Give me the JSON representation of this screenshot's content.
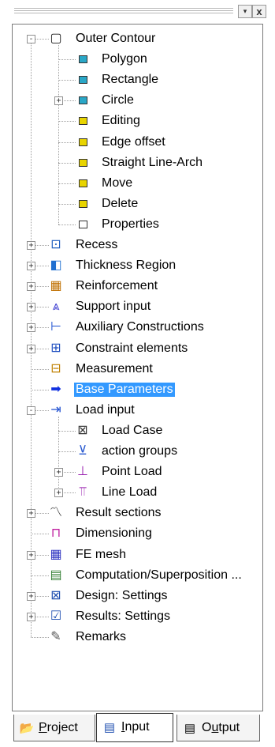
{
  "toolbar": {
    "close_glyph": "x",
    "menu_glyph": "▾"
  },
  "tree": {
    "items": [
      {
        "id": "outer-contour",
        "label": "Outer Contour",
        "level": 0,
        "expander": "-",
        "icon": "outer-contour-icon",
        "glyph": "▢",
        "color": "#1a1a1a"
      },
      {
        "id": "polygon",
        "label": "Polygon",
        "level": 1,
        "expander": "",
        "icon": "polygon-icon",
        "glyph": "sq",
        "color": "#2aa7c7"
      },
      {
        "id": "rectangle",
        "label": "Rectangle",
        "level": 1,
        "expander": "",
        "icon": "rectangle-icon",
        "glyph": "sq",
        "color": "#2aa7c7"
      },
      {
        "id": "circle",
        "label": "Circle",
        "level": 1,
        "expander": "+",
        "icon": "circle-icon",
        "glyph": "sq",
        "color": "#2aa7c7"
      },
      {
        "id": "editing",
        "label": "Editing",
        "level": 1,
        "expander": "",
        "icon": "editing-icon",
        "glyph": "sq",
        "color": "#e8d400"
      },
      {
        "id": "edge-offset",
        "label": "Edge offset",
        "level": 1,
        "expander": "",
        "icon": "edge-offset-icon",
        "glyph": "sq",
        "color": "#e8d400"
      },
      {
        "id": "straight-line-arch",
        "label": "Straight Line-Arch",
        "level": 1,
        "expander": "",
        "icon": "straight-line-arch-icon",
        "glyph": "sq",
        "color": "#e8d400"
      },
      {
        "id": "move",
        "label": "Move",
        "level": 1,
        "expander": "",
        "icon": "move-icon",
        "glyph": "sq",
        "color": "#e8d400"
      },
      {
        "id": "delete",
        "label": "Delete",
        "level": 1,
        "expander": "",
        "icon": "delete-icon",
        "glyph": "sq",
        "color": "#e8d400"
      },
      {
        "id": "properties",
        "label": "Properties",
        "level": 1,
        "expander": "",
        "icon": "properties-icon",
        "glyph": "sq",
        "color": "#ffffff"
      },
      {
        "id": "recess",
        "label": "Recess",
        "level": 0,
        "expander": "+",
        "icon": "recess-icon",
        "glyph": "⊡",
        "color": "#1f5fbf"
      },
      {
        "id": "thickness-region",
        "label": "Thickness Region",
        "level": 0,
        "expander": "+",
        "icon": "thickness-region-icon",
        "glyph": "◧",
        "color": "#1f6fd0"
      },
      {
        "id": "reinforcement",
        "label": "Reinforcement",
        "level": 0,
        "expander": "+",
        "icon": "reinforcement-icon",
        "glyph": "▦",
        "color": "#c07000"
      },
      {
        "id": "support-input",
        "label": "Support input",
        "level": 0,
        "expander": "+",
        "icon": "support-input-icon",
        "glyph": "⩓",
        "color": "#3a3ad0"
      },
      {
        "id": "auxiliary-constructions",
        "label": "Auxiliary Constructions",
        "level": 0,
        "expander": "+",
        "icon": "auxiliary-constructions-icon",
        "glyph": "⊢",
        "color": "#1a4fd0"
      },
      {
        "id": "constraint-elements",
        "label": "Constraint elements",
        "level": 0,
        "expander": "+",
        "icon": "constraint-elements-icon",
        "glyph": "⊞",
        "color": "#1f4fc0"
      },
      {
        "id": "measurement",
        "label": "Measurement",
        "level": 0,
        "expander": "",
        "icon": "measurement-icon",
        "glyph": "⊟",
        "color": "#c08000"
      },
      {
        "id": "base-parameters",
        "label": "Base Parameters",
        "level": 0,
        "expander": "",
        "icon": "arrow-right-icon",
        "glyph": "➡",
        "color": "#1030e0",
        "selected": true
      },
      {
        "id": "load-input",
        "label": "Load input",
        "level": 0,
        "expander": "-",
        "icon": "load-input-icon",
        "glyph": "⇥",
        "color": "#1f4fd0"
      },
      {
        "id": "load-case",
        "label": "Load Case",
        "level": 1,
        "expander": "",
        "icon": "load-case-icon",
        "glyph": "⊠",
        "color": "#333333"
      },
      {
        "id": "action-groups",
        "label": "action groups",
        "level": 1,
        "expander": "",
        "icon": "action-groups-icon",
        "glyph": "⊻",
        "color": "#2a5ad0"
      },
      {
        "id": "point-load",
        "label": "Point Load",
        "level": 1,
        "expander": "+",
        "icon": "point-load-icon",
        "glyph": "⊥",
        "color": "#9a20b0"
      },
      {
        "id": "line-load",
        "label": "Line Load",
        "level": 1,
        "expander": "+",
        "icon": "line-load-icon",
        "glyph": "⫪",
        "color": "#9a20b0"
      },
      {
        "id": "result-sections",
        "label": "Result sections",
        "level": 0,
        "expander": "+",
        "icon": "result-sections-icon",
        "glyph": "〽",
        "color": "#2a2a2a"
      },
      {
        "id": "dimensioning",
        "label": "Dimensioning",
        "level": 0,
        "expander": "",
        "icon": "dimensioning-icon",
        "glyph": "⊓",
        "color": "#c020a0"
      },
      {
        "id": "fe-mesh",
        "label": "FE mesh",
        "level": 0,
        "expander": "+",
        "icon": "fe-mesh-icon",
        "glyph": "▦",
        "color": "#2a30c0"
      },
      {
        "id": "computation",
        "label": "Computation/Superposition ...",
        "level": 0,
        "expander": "",
        "icon": "calculator-icon",
        "glyph": "▤",
        "color": "#2f7d2f"
      },
      {
        "id": "design-settings",
        "label": "Design: Settings",
        "level": 0,
        "expander": "+",
        "icon": "design-settings-icon",
        "glyph": "⊠",
        "color": "#1f4fb0"
      },
      {
        "id": "results-settings",
        "label": "Results: Settings",
        "level": 0,
        "expander": "+",
        "icon": "results-settings-icon",
        "glyph": "☑",
        "color": "#1f4fb0"
      },
      {
        "id": "remarks",
        "label": "Remarks",
        "level": 0,
        "expander": "",
        "icon": "remarks-icon",
        "glyph": "✎",
        "color": "#555555"
      }
    ]
  },
  "tabs": [
    {
      "id": "project",
      "label_pre": "",
      "label_u": "P",
      "label_post": "roject",
      "icon": "folder-icon",
      "glyph": "📂",
      "active": false
    },
    {
      "id": "input",
      "label_pre": "",
      "label_u": "I",
      "label_post": "nput",
      "icon": "input-icon",
      "glyph": "▤",
      "active": true
    },
    {
      "id": "output",
      "label_pre": "O",
      "label_u": "u",
      "label_post": "tput",
      "icon": "output-icon",
      "glyph": "▤",
      "active": false
    }
  ]
}
